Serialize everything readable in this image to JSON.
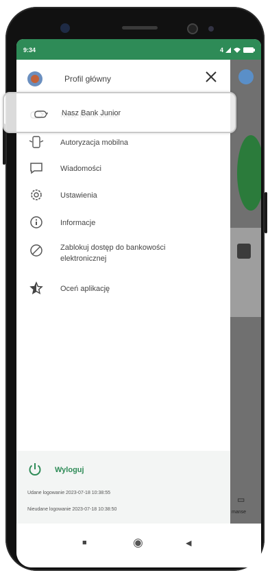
{
  "statusbar": {
    "time": "9:34",
    "icons": "⁴ᐩ ◆ ▭"
  },
  "drawer": {
    "profile_label": "Profil główny",
    "close_icon": "close-icon",
    "items": [
      {
        "label": "Nasz Bank Junior",
        "icon": "junior-piggy-icon"
      },
      {
        "label": "Autoryzacja mobilna",
        "icon": "mobile-auth-icon"
      },
      {
        "label": "Wiadomości",
        "icon": "message-icon"
      },
      {
        "label": "Ustawienia",
        "icon": "gear-icon"
      },
      {
        "label": "Informacje",
        "icon": "info-icon"
      },
      {
        "label": "Zablokuj dostęp do bankowości elektronicznej",
        "icon": "block-icon"
      },
      {
        "label": "Oceń aplikację",
        "icon": "star-rate-icon"
      }
    ],
    "footer": {
      "logout_label": "Wyloguj",
      "success_login": "Udane logowanie 2023-07-18 10:38:55",
      "failed_login": "Nieudane logowanie 2023-07-18 10:38:50"
    }
  },
  "underlay": {
    "bottom_label": "manse"
  },
  "navbar": {
    "recents": "■",
    "home": "◉",
    "back": "◀"
  },
  "colors": {
    "accent": "#2e8b57",
    "overlay": "#707070"
  }
}
